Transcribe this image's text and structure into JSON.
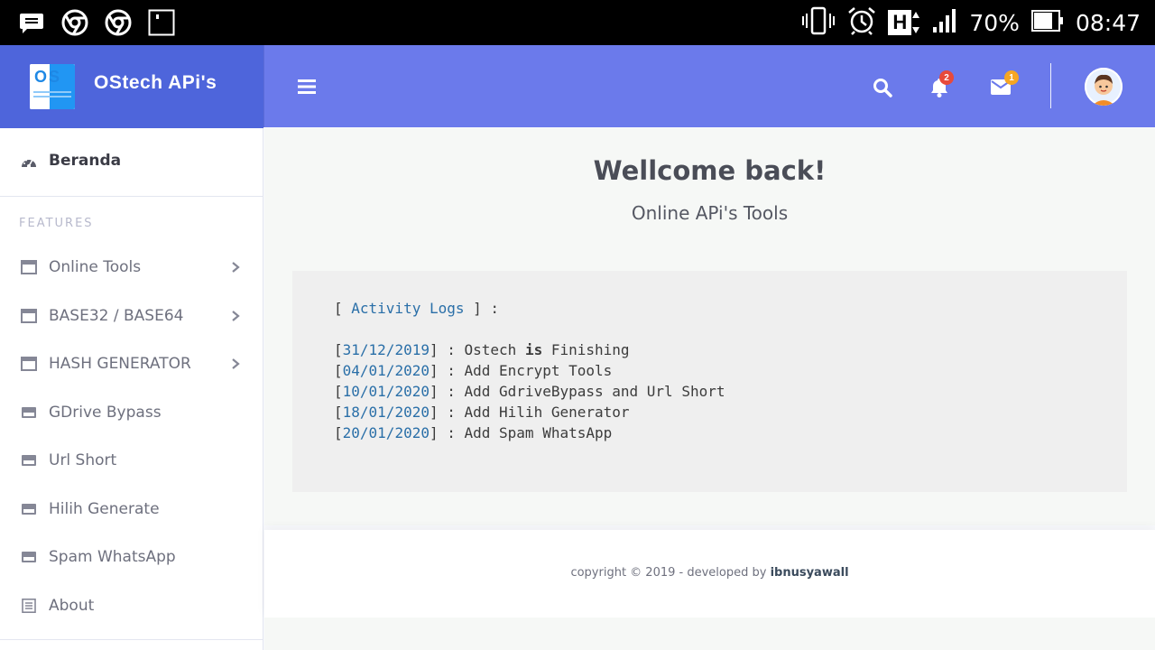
{
  "status_bar": {
    "battery": "70%",
    "time": "08:47",
    "network": "H"
  },
  "brand": {
    "logo_text": "OS",
    "name": "OStech APi's"
  },
  "topbar": {
    "notifications_count": "2",
    "messages_count": "1",
    "badge_colors": {
      "notifications": "#e74a3b",
      "messages": "#f6a623"
    }
  },
  "sidebar": {
    "home": {
      "label": "Beranda",
      "icon": "dashboard-icon"
    },
    "features_heading": "FEATURES",
    "items": [
      {
        "label": "Online Tools",
        "icon": "window-icon",
        "has_submenu": true
      },
      {
        "label": "BASE32 / BASE64",
        "icon": "window-icon",
        "has_submenu": true
      },
      {
        "label": "HASH GENERATOR",
        "icon": "window-icon",
        "has_submenu": true
      },
      {
        "label": "GDrive Bypass",
        "icon": "card-icon",
        "has_submenu": false
      },
      {
        "label": "Url Short",
        "icon": "card-icon",
        "has_submenu": false
      },
      {
        "label": "Hilih Generate",
        "icon": "card-icon",
        "has_submenu": false
      },
      {
        "label": "Spam WhatsApp",
        "icon": "card-icon",
        "has_submenu": false
      },
      {
        "label": "About",
        "icon": "document-icon",
        "has_submenu": false
      }
    ]
  },
  "main": {
    "title": "Wellcome back!",
    "subtitle": "Online APi's Tools",
    "activity": {
      "open": "[ ",
      "label": "Activity Logs",
      "close": " ] :",
      "entries": [
        {
          "date": "31/12/2019",
          "prefix": "Ostech ",
          "bold": "is",
          "suffix": " Finishing"
        },
        {
          "date": "04/01/2020",
          "prefix": "Add Encrypt Tools",
          "bold": "",
          "suffix": ""
        },
        {
          "date": "10/01/2020",
          "prefix": "Add GdriveBypass and Url Short",
          "bold": "",
          "suffix": ""
        },
        {
          "date": "18/01/2020",
          "prefix": "Add Hilih Generator",
          "bold": "",
          "suffix": ""
        },
        {
          "date": "20/01/2020",
          "prefix": "Add Spam WhatsApp",
          "bold": "",
          "suffix": ""
        }
      ]
    }
  },
  "footer": {
    "text": "copyright © 2019 - developed by ",
    "author": "ibnusyawall"
  },
  "colors": {
    "brand_bg": "#4e65db",
    "topbar_bg": "#6b7aeb",
    "link": "#2a6fa8"
  }
}
